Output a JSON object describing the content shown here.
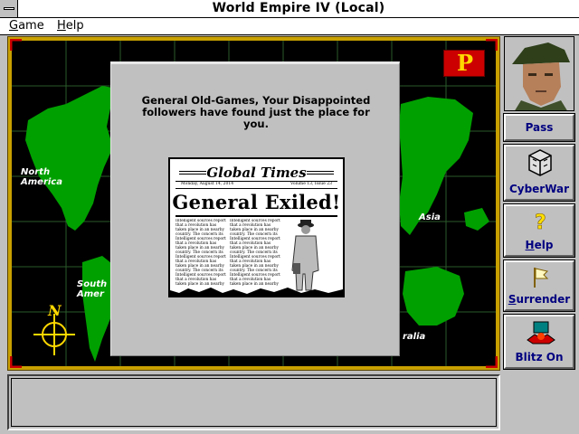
{
  "window": {
    "title": "World Empire IV (Local)"
  },
  "menu": {
    "items": [
      {
        "label": "Game"
      },
      {
        "label": "Help"
      }
    ]
  },
  "map": {
    "labels": {
      "north_america": "North\nAmerica",
      "south_america": "South\nAmer",
      "asia": "Asia",
      "australia": "ralia"
    },
    "player_flag": "P",
    "colors": {
      "land": "#00a000",
      "sea": "#000000",
      "grid": "#2a5a2a",
      "frame": "#c8a000",
      "compass": "#ffd800"
    }
  },
  "dialog": {
    "message": "General Old-Games, Your Disappointed followers have found just the place for you.",
    "newspaper": {
      "name": "Global Times",
      "date": "Monday, August 14, 2014",
      "volume": "Volume 13, Issue 23",
      "headline": "General Exiled!",
      "body": "Intelligent sources report that a revolution has taken place in an nearby country. The concern its Intelligent sources report that a revolution has taken place in an nearby country. The concern its Intelligent sources report that a revolution has taken place in an nearby country. The concern its Intelligent sources report that a revolution has taken place in an nearby"
    }
  },
  "sidebar": {
    "portrait": "general-portrait",
    "buttons": [
      {
        "label": "Pass",
        "icon": "none"
      },
      {
        "label": "CyberWar",
        "icon": "cyberwar-icon"
      },
      {
        "label": "Help",
        "icon": "question-icon"
      },
      {
        "label": "Surrender",
        "icon": "white-flag-icon"
      },
      {
        "label": "Blitz On",
        "icon": "blitz-icon"
      }
    ]
  },
  "status": {
    "text": ""
  }
}
